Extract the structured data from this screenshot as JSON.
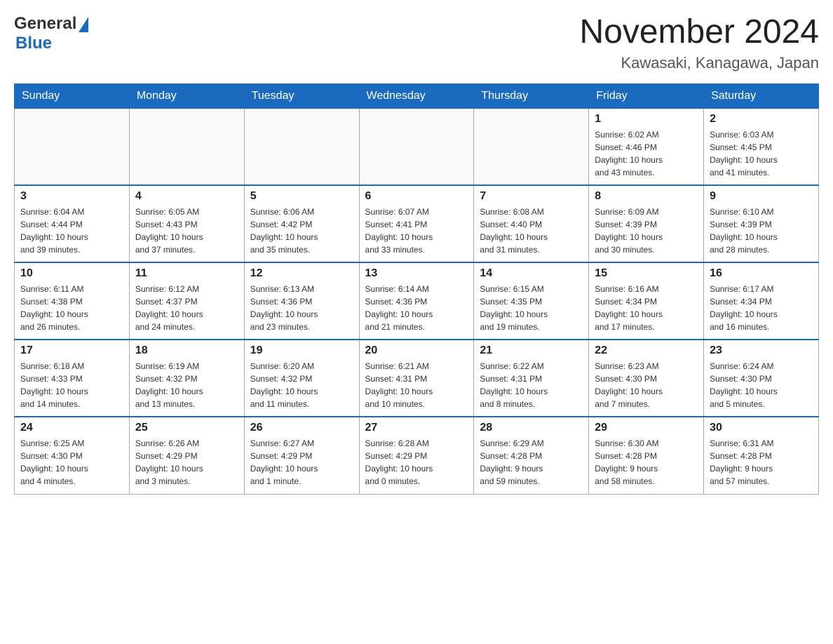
{
  "header": {
    "logo_general": "General",
    "logo_blue": "Blue",
    "title": "November 2024",
    "subtitle": "Kawasaki, Kanagawa, Japan"
  },
  "days_of_week": [
    "Sunday",
    "Monday",
    "Tuesday",
    "Wednesday",
    "Thursday",
    "Friday",
    "Saturday"
  ],
  "weeks": [
    [
      {
        "day": "",
        "info": ""
      },
      {
        "day": "",
        "info": ""
      },
      {
        "day": "",
        "info": ""
      },
      {
        "day": "",
        "info": ""
      },
      {
        "day": "",
        "info": ""
      },
      {
        "day": "1",
        "info": "Sunrise: 6:02 AM\nSunset: 4:46 PM\nDaylight: 10 hours\nand 43 minutes."
      },
      {
        "day": "2",
        "info": "Sunrise: 6:03 AM\nSunset: 4:45 PM\nDaylight: 10 hours\nand 41 minutes."
      }
    ],
    [
      {
        "day": "3",
        "info": "Sunrise: 6:04 AM\nSunset: 4:44 PM\nDaylight: 10 hours\nand 39 minutes."
      },
      {
        "day": "4",
        "info": "Sunrise: 6:05 AM\nSunset: 4:43 PM\nDaylight: 10 hours\nand 37 minutes."
      },
      {
        "day": "5",
        "info": "Sunrise: 6:06 AM\nSunset: 4:42 PM\nDaylight: 10 hours\nand 35 minutes."
      },
      {
        "day": "6",
        "info": "Sunrise: 6:07 AM\nSunset: 4:41 PM\nDaylight: 10 hours\nand 33 minutes."
      },
      {
        "day": "7",
        "info": "Sunrise: 6:08 AM\nSunset: 4:40 PM\nDaylight: 10 hours\nand 31 minutes."
      },
      {
        "day": "8",
        "info": "Sunrise: 6:09 AM\nSunset: 4:39 PM\nDaylight: 10 hours\nand 30 minutes."
      },
      {
        "day": "9",
        "info": "Sunrise: 6:10 AM\nSunset: 4:39 PM\nDaylight: 10 hours\nand 28 minutes."
      }
    ],
    [
      {
        "day": "10",
        "info": "Sunrise: 6:11 AM\nSunset: 4:38 PM\nDaylight: 10 hours\nand 26 minutes."
      },
      {
        "day": "11",
        "info": "Sunrise: 6:12 AM\nSunset: 4:37 PM\nDaylight: 10 hours\nand 24 minutes."
      },
      {
        "day": "12",
        "info": "Sunrise: 6:13 AM\nSunset: 4:36 PM\nDaylight: 10 hours\nand 23 minutes."
      },
      {
        "day": "13",
        "info": "Sunrise: 6:14 AM\nSunset: 4:36 PM\nDaylight: 10 hours\nand 21 minutes."
      },
      {
        "day": "14",
        "info": "Sunrise: 6:15 AM\nSunset: 4:35 PM\nDaylight: 10 hours\nand 19 minutes."
      },
      {
        "day": "15",
        "info": "Sunrise: 6:16 AM\nSunset: 4:34 PM\nDaylight: 10 hours\nand 17 minutes."
      },
      {
        "day": "16",
        "info": "Sunrise: 6:17 AM\nSunset: 4:34 PM\nDaylight: 10 hours\nand 16 minutes."
      }
    ],
    [
      {
        "day": "17",
        "info": "Sunrise: 6:18 AM\nSunset: 4:33 PM\nDaylight: 10 hours\nand 14 minutes."
      },
      {
        "day": "18",
        "info": "Sunrise: 6:19 AM\nSunset: 4:32 PM\nDaylight: 10 hours\nand 13 minutes."
      },
      {
        "day": "19",
        "info": "Sunrise: 6:20 AM\nSunset: 4:32 PM\nDaylight: 10 hours\nand 11 minutes."
      },
      {
        "day": "20",
        "info": "Sunrise: 6:21 AM\nSunset: 4:31 PM\nDaylight: 10 hours\nand 10 minutes."
      },
      {
        "day": "21",
        "info": "Sunrise: 6:22 AM\nSunset: 4:31 PM\nDaylight: 10 hours\nand 8 minutes."
      },
      {
        "day": "22",
        "info": "Sunrise: 6:23 AM\nSunset: 4:30 PM\nDaylight: 10 hours\nand 7 minutes."
      },
      {
        "day": "23",
        "info": "Sunrise: 6:24 AM\nSunset: 4:30 PM\nDaylight: 10 hours\nand 5 minutes."
      }
    ],
    [
      {
        "day": "24",
        "info": "Sunrise: 6:25 AM\nSunset: 4:30 PM\nDaylight: 10 hours\nand 4 minutes."
      },
      {
        "day": "25",
        "info": "Sunrise: 6:26 AM\nSunset: 4:29 PM\nDaylight: 10 hours\nand 3 minutes."
      },
      {
        "day": "26",
        "info": "Sunrise: 6:27 AM\nSunset: 4:29 PM\nDaylight: 10 hours\nand 1 minute."
      },
      {
        "day": "27",
        "info": "Sunrise: 6:28 AM\nSunset: 4:29 PM\nDaylight: 10 hours\nand 0 minutes."
      },
      {
        "day": "28",
        "info": "Sunrise: 6:29 AM\nSunset: 4:28 PM\nDaylight: 9 hours\nand 59 minutes."
      },
      {
        "day": "29",
        "info": "Sunrise: 6:30 AM\nSunset: 4:28 PM\nDaylight: 9 hours\nand 58 minutes."
      },
      {
        "day": "30",
        "info": "Sunrise: 6:31 AM\nSunset: 4:28 PM\nDaylight: 9 hours\nand 57 minutes."
      }
    ]
  ]
}
